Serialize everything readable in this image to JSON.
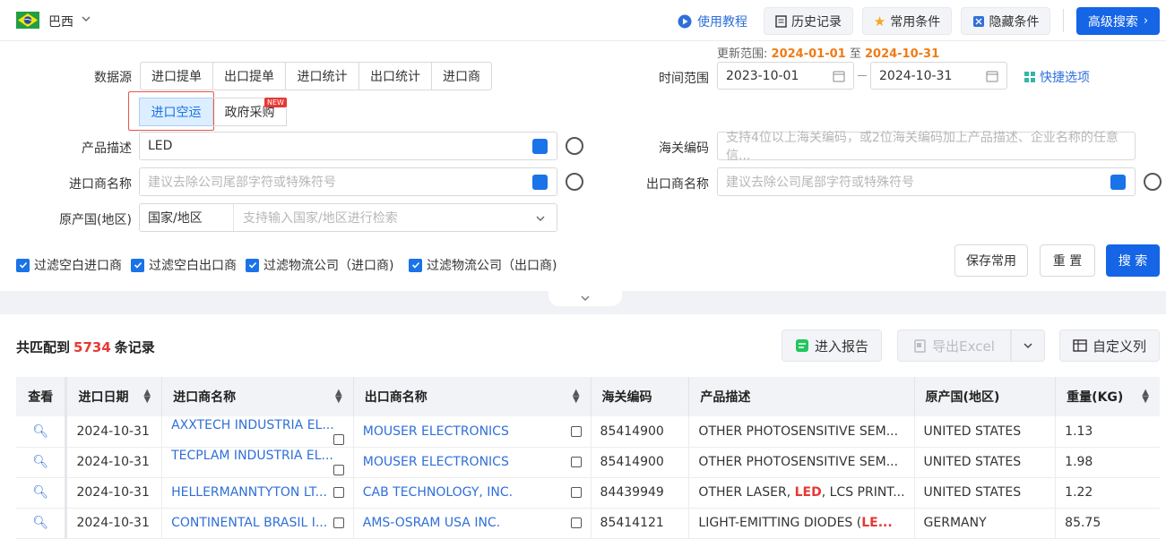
{
  "header": {
    "country": "巴西",
    "tutorial": "使用教程",
    "history": "历史记录",
    "common_conditions": "常用条件",
    "hidden_conditions": "隐藏条件",
    "advanced_search": "高级搜索"
  },
  "filters": {
    "datasource_label": "数据源",
    "datasource_tabs": [
      "进口提单",
      "出口提单",
      "进口统计",
      "出口统计",
      "进口商",
      "进口空运",
      "政府采购"
    ],
    "selected_tab": "进口空运",
    "new_badge": "NEW",
    "update_range_label": "更新范围:",
    "update_from": "2024-01-01",
    "update_to_sep": "至",
    "update_to": "2024-10-31",
    "time_range_label": "时间范围",
    "date_from": "2023-10-01",
    "date_to": "2024-10-31",
    "quick_options": "快捷选项",
    "product_label": "产品描述",
    "product_value": "LED",
    "hs_label": "海关编码",
    "hs_placeholder": "支持4位以上海关编码，或2位海关编码加上产品描述、企业名称的任意信...",
    "importer_label": "进口商名称",
    "importer_placeholder": "建议去除公司尾部字符或特殊符号",
    "exporter_label": "出口商名称",
    "exporter_placeholder": "建议去除公司尾部字符或特殊符号",
    "origin_label": "原产国(地区)",
    "origin_type": "国家/地区",
    "origin_placeholder": "支持输入国家/地区进行检索",
    "checkboxes": [
      "过滤空白进口商",
      "过滤空白出口商",
      "过滤物流公司（进口商)",
      "过滤物流公司（出口商)"
    ],
    "save_common": "保存常用",
    "reset": "重 置",
    "search": "搜 索"
  },
  "results": {
    "prefix": "共匹配到",
    "count": "5734",
    "suffix": "条记录",
    "report": "进入报告",
    "export": "导出Excel",
    "custom_columns": "自定义列",
    "columns": [
      "查看",
      "进口日期",
      "进口商名称",
      "出口商名称",
      "海关编码",
      "产品描述",
      "原产国(地区)",
      "重量(KG)"
    ],
    "rows": [
      {
        "date": "2024-10-31",
        "importer": "AXXTECH INDUSTRIA EL...",
        "exporter": "MOUSER ELECTRONICS",
        "hs": "85414900",
        "desc_pre": "OTHER PHOTOSENSITIVE SEM...",
        "desc_hl": "",
        "desc_post": "",
        "origin": "UNITED STATES",
        "weight": "1.13"
      },
      {
        "date": "2024-10-31",
        "importer": "TECPLAM INDUSTRIA EL...",
        "exporter": "MOUSER ELECTRONICS",
        "hs": "85414900",
        "desc_pre": "OTHER PHOTOSENSITIVE SEM...",
        "desc_hl": "",
        "desc_post": "",
        "origin": "UNITED STATES",
        "weight": "1.98"
      },
      {
        "date": "2024-10-31",
        "importer": "HELLERMANNTYTON LT...",
        "exporter": "CAB TECHNOLOGY, INC.",
        "hs": "84439949",
        "desc_pre": "OTHER LASER, ",
        "desc_hl": "LED",
        "desc_post": ", LCS PRINT...",
        "origin": "UNITED STATES",
        "weight": "1.22"
      },
      {
        "date": "2024-10-31",
        "importer": "CONTINENTAL BRASIL I...",
        "exporter": "AMS-OSRAM USA INC.",
        "hs": "85414121",
        "desc_pre": "LIGHT-EMITTING DIODES (",
        "desc_hl": "LE...",
        "desc_post": "",
        "origin": "GERMANY",
        "weight": "85.75"
      }
    ]
  },
  "colors": {
    "primary": "#1565e6",
    "accent_orange": "#f07b16",
    "highlight_red": "#e53935"
  }
}
